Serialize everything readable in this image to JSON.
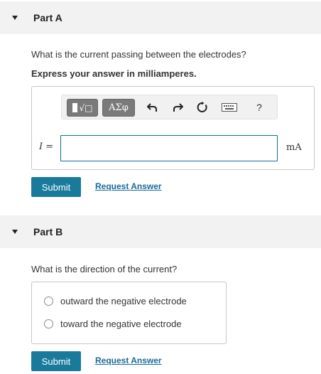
{
  "part_a": {
    "title": "Part A",
    "question": "What is the current passing between the electrodes?",
    "instruction": "Express your answer in milliamperes.",
    "toolbar": {
      "template_label": "√□",
      "greek_label": "ΑΣφ",
      "undo_icon": "undo-icon",
      "redo_icon": "redo-icon",
      "reset_icon": "reset-icon",
      "keyboard_icon": "keyboard-icon",
      "help_label": "?"
    },
    "variable": "I",
    "equals": "=",
    "answer_value": "",
    "unit": "mA",
    "submit_label": "Submit",
    "request_label": "Request Answer"
  },
  "part_b": {
    "title": "Part B",
    "question": "What is the direction of the current?",
    "options": [
      "outward the negative electrode",
      "toward the negative electrode"
    ],
    "submit_label": "Submit",
    "request_label": "Request Answer"
  },
  "colors": {
    "submit_bg": "#1a7a9c",
    "link": "#1a6c99",
    "header_bg": "#f2f2f2",
    "input_border": "#0d6e91"
  }
}
